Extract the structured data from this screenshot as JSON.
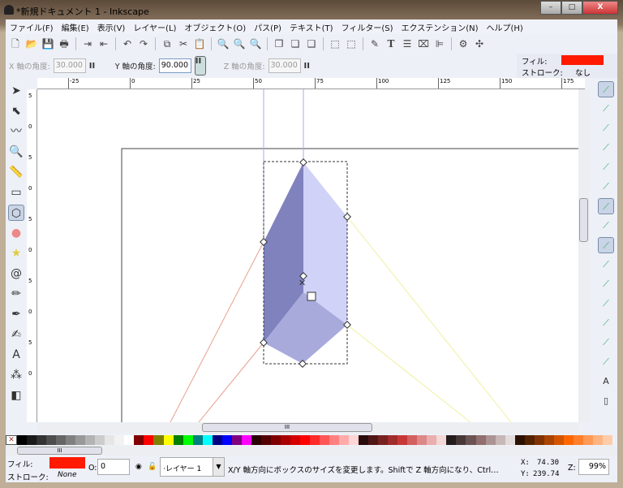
{
  "window": {
    "title": "*新規ドキュメント 1 - Inkscape",
    "minimize": "–",
    "maximize": "□",
    "close": "X"
  },
  "menu": [
    "ファイル(F)",
    "編集(E)",
    "表示(V)",
    "レイヤー(L)",
    "オブジェクト(O)",
    "パス(P)",
    "テキスト(T)",
    "フィルター(S)",
    "エクステンション(N)",
    "ヘルプ(H)"
  ],
  "toolbar": [
    "new-icon",
    "open-icon",
    "save-icon",
    "print-icon",
    "|",
    "import-icon",
    "export-icon",
    "|",
    "undo-icon",
    "redo-icon",
    "|",
    "copy-icon",
    "cut-icon",
    "paste-icon",
    "|",
    "zoom-selection-icon",
    "zoom-drawing-icon",
    "zoom-page-icon",
    "|",
    "duplicate-icon",
    "clone-icon",
    "unlink-clone-icon",
    "|",
    "group-icon",
    "ungroup-icon",
    "|",
    "fill-stroke-icon",
    "text-icon",
    "layers-icon",
    "xml-editor-icon",
    "align-icon",
    "|",
    "preferences-icon",
    "document-properties-icon"
  ],
  "controls": {
    "x_label": "X 軸の角度:",
    "x_value": "30.000",
    "y_label": "Y 軸の角度:",
    "y_value": "90.000",
    "z_label": "Z 軸の角度:",
    "z_value": "30.000",
    "lock": "II"
  },
  "style_indicator": {
    "fill_label": "フィル:",
    "fill_color": "#ff1a00",
    "stroke_label": "ストローク:",
    "stroke_value": "なし"
  },
  "ruler_h": [
    "-25",
    "0",
    "25",
    "50",
    "75",
    "100",
    "125",
    "150",
    "175"
  ],
  "ruler_v": [
    "5",
    "0",
    "5",
    "0",
    "5",
    "0",
    "5",
    "0",
    "5",
    "0"
  ],
  "left_tools": [
    "selector-icon",
    "node-icon",
    "tweak-icon",
    "zoom-icon",
    "measure-icon",
    "rect-icon",
    "3dbox-icon",
    "ellipse-icon",
    "star-icon",
    "spiral-icon",
    "pencil-icon",
    "pen-icon",
    "calligraphy-icon",
    "text-icon",
    "spray-icon",
    "eraser-icon"
  ],
  "left_tools_selected": "3dbox-icon",
  "right_tools": [
    "snap-enable",
    "snap-bbox",
    "snap-bbox-edge",
    "snap-bbox-corner",
    "snap-bbox-mid",
    "snap-bbox-center",
    "snap-nodes",
    "snap-path",
    "snap-intersection",
    "snap-cusp",
    "snap-smooth",
    "snap-midpoint",
    "snap-object-center",
    "snap-rotation-center",
    "snap-guide",
    "snap-text-baseline",
    "snap-page"
  ],
  "palette": [
    "#000000",
    "#1a1a1a",
    "#333333",
    "#4d4d4d",
    "#666666",
    "#808080",
    "#999999",
    "#b3b3b3",
    "#cccccc",
    "#e6e6e6",
    "#f2f2f2",
    "#ffffff",
    "#800000",
    "#ff0000",
    "#808000",
    "#ffff00",
    "#008000",
    "#00ff00",
    "#008080",
    "#00ffff",
    "#000080",
    "#0000ff",
    "#800080",
    "#ff00ff",
    "#2b0000",
    "#550000",
    "#800000",
    "#aa0000",
    "#d40000",
    "#ff0000",
    "#ff2a2a",
    "#ff5555",
    "#ff8080",
    "#ffaaaa",
    "#ffd5d5",
    "#280b0b",
    "#501616",
    "#782121",
    "#a02c2c",
    "#c83737",
    "#d35f5f",
    "#de8787",
    "#e9afaf",
    "#f4d7d7",
    "#241c1c",
    "#483737",
    "#6c5353",
    "#916f6f",
    "#ac9393",
    "#c8b7b7",
    "#e3dbdb",
    "#2b1100",
    "#552200",
    "#803300",
    "#aa4400",
    "#d45500",
    "#ff6600",
    "#ff7f2a",
    "#ff9955",
    "#ffb380",
    "#ffccaa"
  ],
  "status": {
    "fill_label": "フィル:",
    "fill_color": "#ff1a00",
    "stroke_label": "ストローク:",
    "stroke_value": "None",
    "opacity_label": "O:",
    "opacity_value": "0",
    "layer": "·レイヤー 1",
    "message": "X/Y 軸方向にボックスのサイズを変更します。Shiftで Z 軸方向になり、Ctrl…",
    "x_label": "X:",
    "x_value": "74.30",
    "y_label": "Y:",
    "y_value": "239.74",
    "zoom_label": "Z:",
    "zoom_value": "99%"
  },
  "box_colors": {
    "left": "#7f82bd",
    "right": "#d0d2f7",
    "bottom": "#a8aadc",
    "x_lines": "#e8a090",
    "y_lines": "#a8aaf0",
    "z_lines": "#f0f0a0"
  }
}
